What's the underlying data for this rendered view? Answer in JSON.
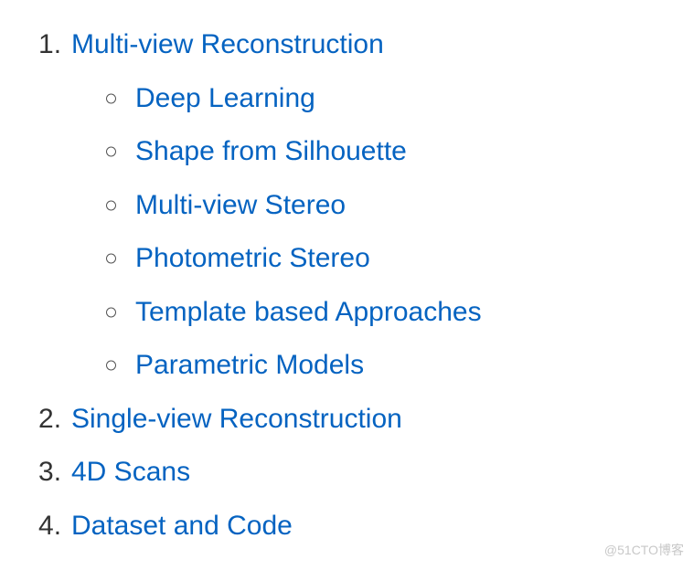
{
  "toc": [
    {
      "label": "Multi-view Reconstruction",
      "children": [
        {
          "label": "Deep Learning"
        },
        {
          "label": "Shape from Silhouette"
        },
        {
          "label": "Multi-view Stereo"
        },
        {
          "label": "Photometric Stereo"
        },
        {
          "label": "Template based Approaches"
        },
        {
          "label": "Parametric Models"
        }
      ]
    },
    {
      "label": "Single-view Reconstruction",
      "children": []
    },
    {
      "label": "4D Scans",
      "children": []
    },
    {
      "label": "Dataset and Code",
      "children": []
    }
  ],
  "watermark": "@51CTO博客"
}
